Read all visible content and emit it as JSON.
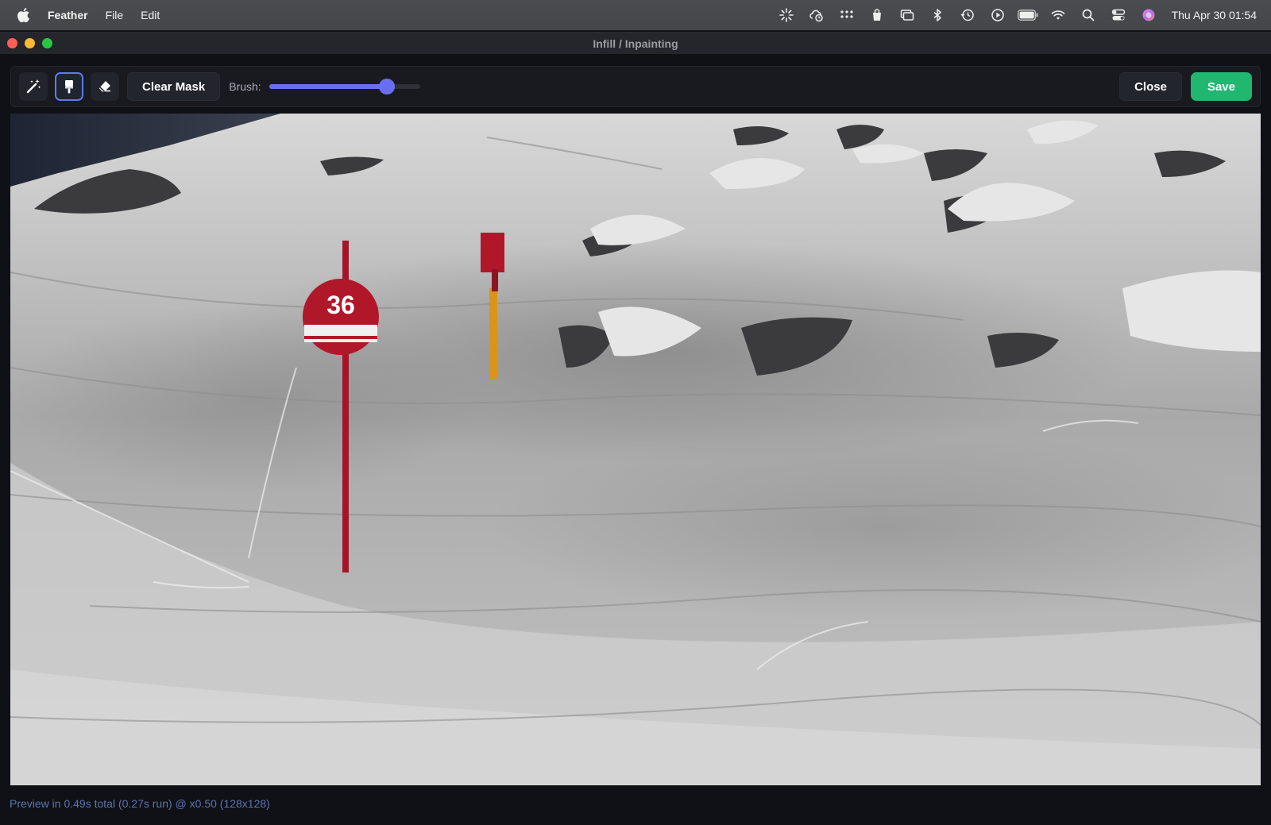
{
  "menubar": {
    "app_name": "Feather",
    "menus": [
      "File",
      "Edit"
    ],
    "clock": "Thu Apr 30  01:54",
    "status_icons": [
      "spark-icon",
      "cloud-clock-icon",
      "grid-dots-icon",
      "bag-icon",
      "display-icon",
      "bluetooth-icon",
      "time-machine-icon",
      "play-icon",
      "battery-icon",
      "wifi-icon",
      "search-icon",
      "control-center-icon",
      "siri-icon"
    ]
  },
  "window": {
    "title": "Infill / Inpainting"
  },
  "toolbar": {
    "tools": [
      "magic-wand-icon",
      "brush-icon",
      "eraser-icon"
    ],
    "active_tool": "brush-icon",
    "clear_mask_label": "Clear Mask",
    "brush_label": "Brush:",
    "brush_value": 0.78,
    "close_label": "Close",
    "save_label": "Save"
  },
  "status": {
    "text": "Preview in 0.49s total (0.27s run) @ x0.50 (128x128)"
  },
  "image": {
    "sign_number": "36"
  },
  "colors": {
    "accent": "#6a6ff2",
    "save": "#20b771",
    "sign_red": "#b0182a"
  }
}
